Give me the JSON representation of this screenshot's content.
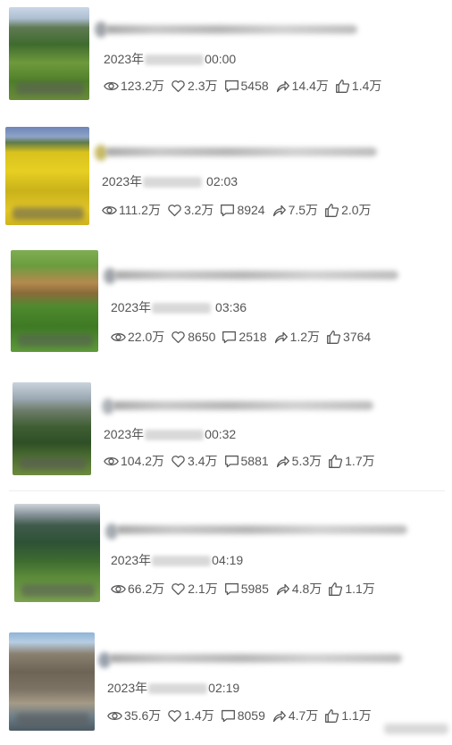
{
  "posts": [
    {
      "date_prefix": "2023年",
      "time": "00:00",
      "views": "123.2万",
      "likes": "2.3万",
      "comments": "5458",
      "shares": "14.4万",
      "upvotes": "1.4万"
    },
    {
      "date_prefix": "2023年",
      "time": "02:03",
      "views": "111.2万",
      "likes": "3.2万",
      "comments": "8924",
      "shares": "7.5万",
      "upvotes": "2.0万"
    },
    {
      "date_prefix": "2023年",
      "time": "03:36",
      "views": "22.0万",
      "likes": "8650",
      "comments": "2518",
      "shares": "1.2万",
      "upvotes": "3764"
    },
    {
      "date_prefix": "2023年",
      "time": "00:32",
      "views": "104.2万",
      "likes": "3.4万",
      "comments": "5881",
      "shares": "5.3万",
      "upvotes": "1.7万"
    },
    {
      "date_prefix": "2023年",
      "time": "04:19",
      "views": "66.2万",
      "likes": "2.1万",
      "comments": "5985",
      "shares": "4.8万",
      "upvotes": "1.1万"
    },
    {
      "date_prefix": "2023年",
      "time": "02:19",
      "views": "35.6万",
      "likes": "1.4万",
      "comments": "8059",
      "shares": "4.7万",
      "upvotes": "1.1万"
    }
  ],
  "icons": {
    "views": "eye-icon",
    "likes": "heart-icon",
    "comments": "comment-icon",
    "shares": "share-icon",
    "upvotes": "thumbs-up-icon"
  },
  "colors": {
    "text": "#555555",
    "background": "#ffffff"
  }
}
